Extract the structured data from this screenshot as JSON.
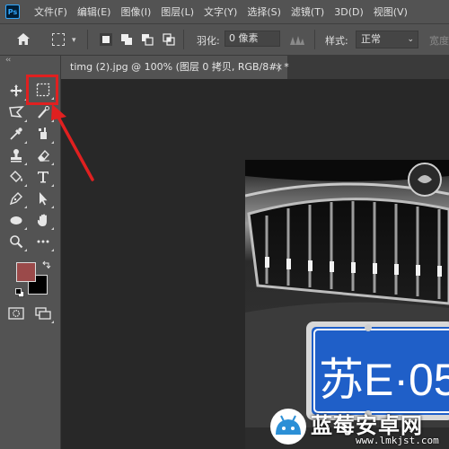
{
  "app": {
    "logo_text": "Ps"
  },
  "menu": [
    {
      "label": "文件(F)"
    },
    {
      "label": "编辑(E)"
    },
    {
      "label": "图像(I)"
    },
    {
      "label": "图层(L)"
    },
    {
      "label": "文字(Y)"
    },
    {
      "label": "选择(S)"
    },
    {
      "label": "滤镜(T)"
    },
    {
      "label": "3D(D)"
    },
    {
      "label": "视图(V)"
    }
  ],
  "options": {
    "feather_label": "羽化:",
    "feather_value": "0 像素",
    "style_label": "样式:",
    "style_value": "正常",
    "width_label": "宽度"
  },
  "toolbar": {
    "collapse_glyph": "‹‹"
  },
  "document": {
    "tab_title": "timg (2).jpg @ 100% (图层 0 拷贝, RGB/8#) *",
    "tab_close": "×"
  },
  "photo": {
    "plate_text": "苏E·05"
  },
  "colors": {
    "foreground": "#9b4a4a",
    "background": "#000000",
    "highlight": "#e02020",
    "plate_blue": "#1f5fc8"
  },
  "watermark": {
    "title": "蓝莓安卓网",
    "url": "www.lmkjst.com"
  }
}
